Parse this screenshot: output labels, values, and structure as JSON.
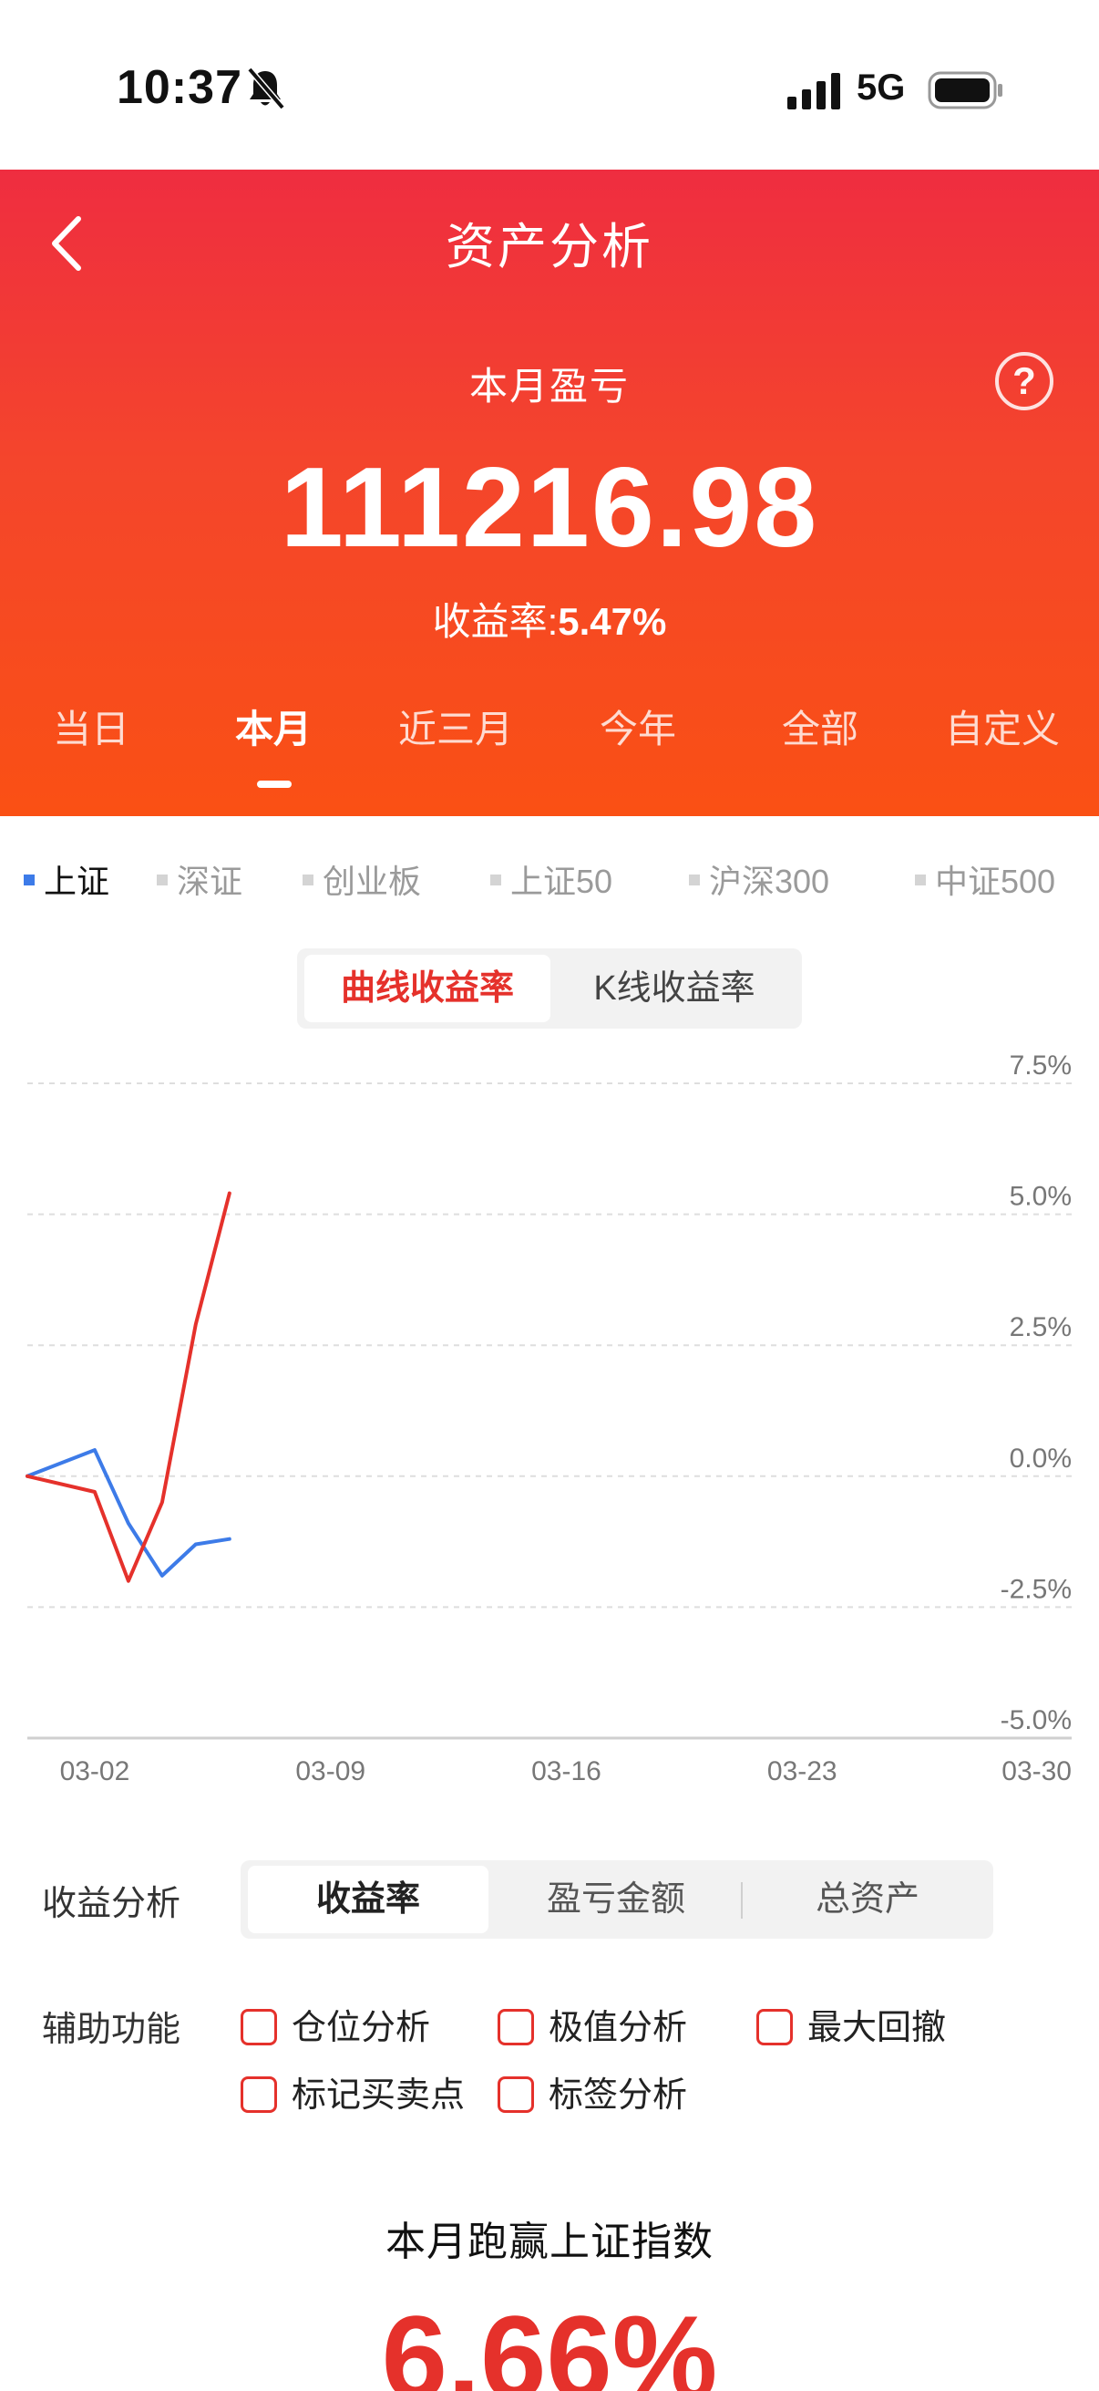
{
  "status_bar": {
    "time": "10:37",
    "network": "5G"
  },
  "header": {
    "title": "资产分析",
    "subtitle": "本月盈亏",
    "help": "?",
    "amount": "111216.98",
    "rate_label": "收益率:",
    "rate_value": "5.47%",
    "tabs": [
      "当日",
      "本月",
      "近三月",
      "今年",
      "全部",
      "自定义"
    ],
    "active_tab": "本月"
  },
  "index_tabs": [
    "上证",
    "深证",
    "创业板",
    "上证50",
    "沪深300",
    "中证500"
  ],
  "active_index": "上证",
  "chart_toggle": {
    "options": [
      "曲线收益率",
      "K线收益率"
    ],
    "active": "曲线收益率"
  },
  "chart_data": {
    "type": "line",
    "x_ticks": [
      "03-02",
      "03-09",
      "03-16",
      "03-23",
      "03-30"
    ],
    "y_ticks": [
      "7.5%",
      "5.0%",
      "2.5%",
      "0.0%",
      "-2.5%",
      "-5.0%"
    ],
    "ylim": [
      -5.0,
      7.5
    ],
    "x_range": [
      "02-28",
      "03-31"
    ],
    "series": [
      {
        "color": "#3d7be8",
        "x": [
          "02-28",
          "03-02",
          "03-03",
          "03-04",
          "03-05",
          "03-06"
        ],
        "values": [
          0.0,
          0.5,
          -0.9,
          -1.9,
          -1.3,
          -1.2
        ]
      },
      {
        "color": "#e5312b",
        "x": [
          "02-28",
          "03-02",
          "03-03",
          "03-04",
          "03-05",
          "03-06"
        ],
        "values": [
          0.0,
          -0.3,
          -2.0,
          -0.5,
          2.9,
          5.4
        ]
      }
    ]
  },
  "analysis": {
    "label": "收益分析",
    "options": [
      "收益率",
      "盈亏金额",
      "总资产"
    ],
    "active": "收益率"
  },
  "aux": {
    "label": "辅助功能",
    "items": [
      "仓位分析",
      "极值分析",
      "最大回撤",
      "标记买卖点",
      "标签分析"
    ]
  },
  "beat": {
    "title": "本月跑赢上证指数",
    "value": "6.66%"
  },
  "colors": {
    "accent": "#e5312b",
    "blue_series": "#3d7be8"
  }
}
